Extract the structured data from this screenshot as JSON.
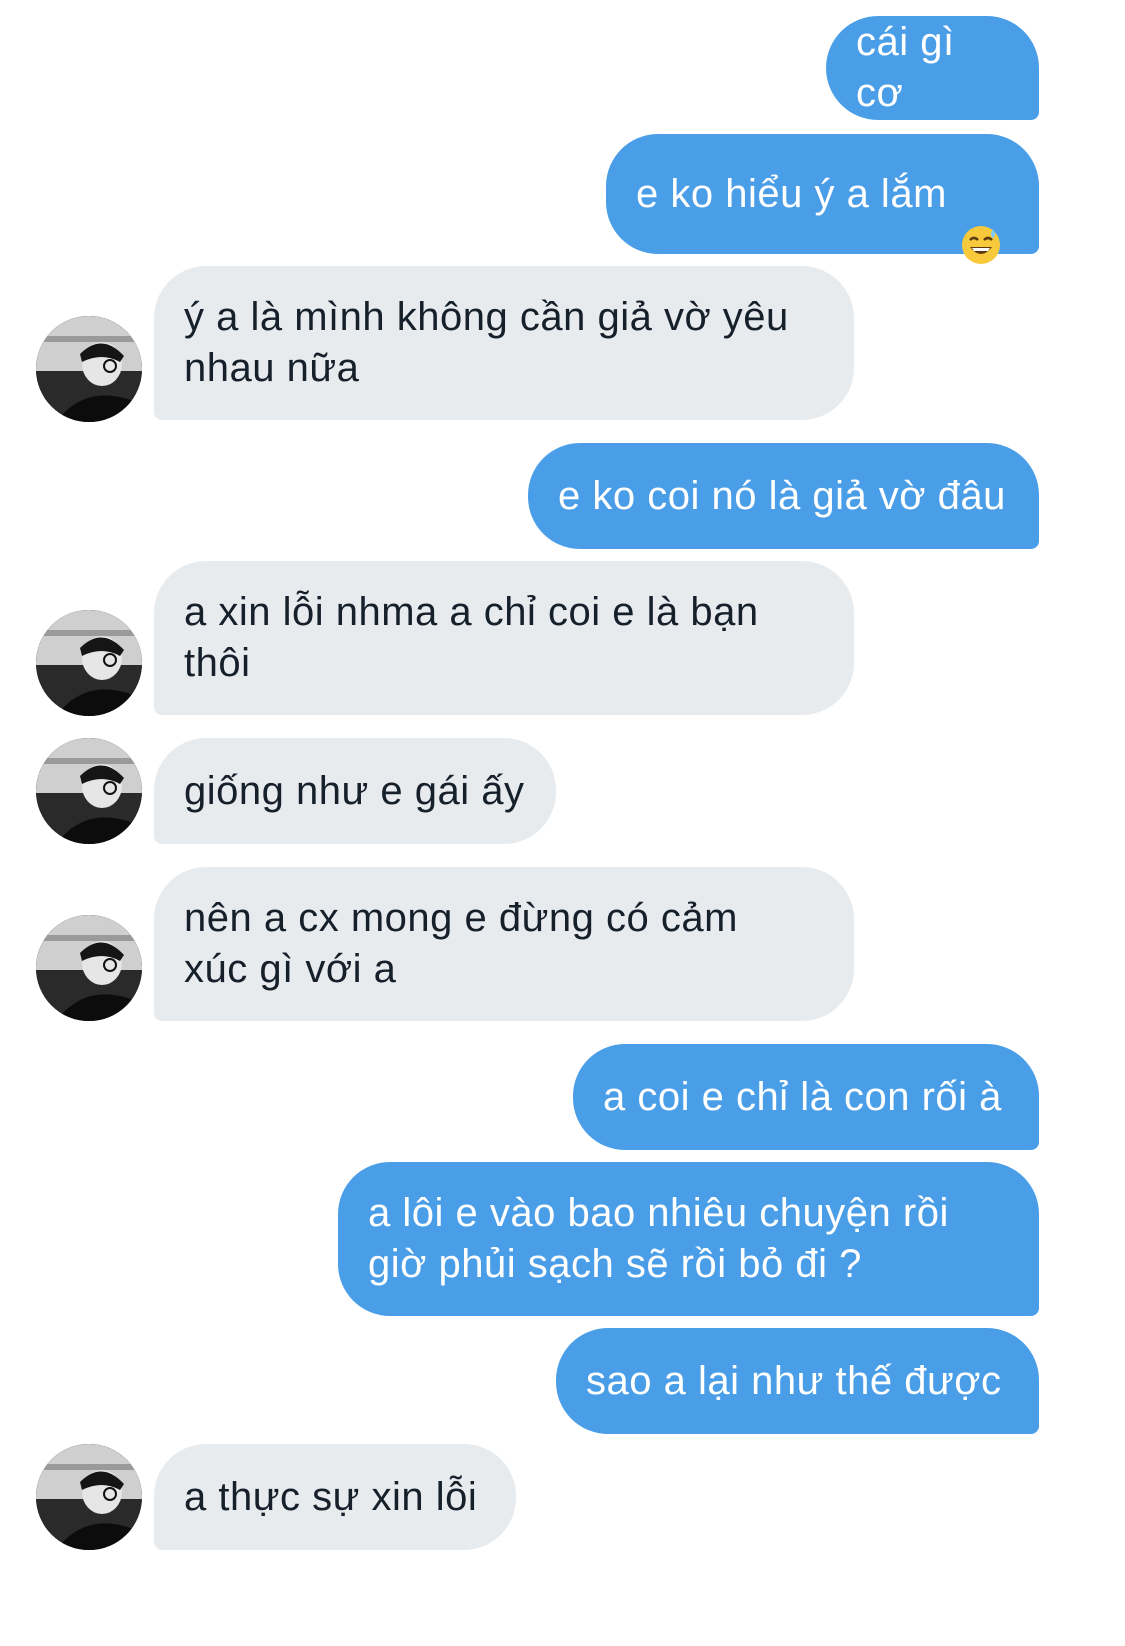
{
  "messages": [
    {
      "side": "sent",
      "text": "cái gì cơ"
    },
    {
      "side": "sent",
      "text": "e ko hiểu ý a lắm",
      "emoji": "grinning-sweat-emoji"
    },
    {
      "side": "received",
      "text": "ý a là mình không cần giả vờ yêu\nnhau nữa"
    },
    {
      "side": "sent",
      "text": "e ko coi nó là giả vờ đâu"
    },
    {
      "side": "received",
      "text": "a xin lỗi nhma a chỉ coi e là bạn\nthôi"
    },
    {
      "side": "received",
      "text": "giống như e gái ấy"
    },
    {
      "side": "received",
      "text": "nên a cx mong e đừng có cảm\nxúc gì với a"
    },
    {
      "side": "sent",
      "text": "a coi e chỉ là con rối à"
    },
    {
      "side": "sent",
      "text": "a lôi e vào bao nhiêu chuyện rồi\ngiờ phủi sạch sẽ rồi bỏ đi ?"
    },
    {
      "side": "sent",
      "text": "sao a lại như thế được"
    },
    {
      "side": "received",
      "text": "a thực sự xin lỗi"
    }
  ],
  "colors": {
    "sent_bubble": "#4a9ee8",
    "received_bubble": "#e8ebee",
    "sent_text": "#ffffff",
    "received_text": "#16202b"
  }
}
